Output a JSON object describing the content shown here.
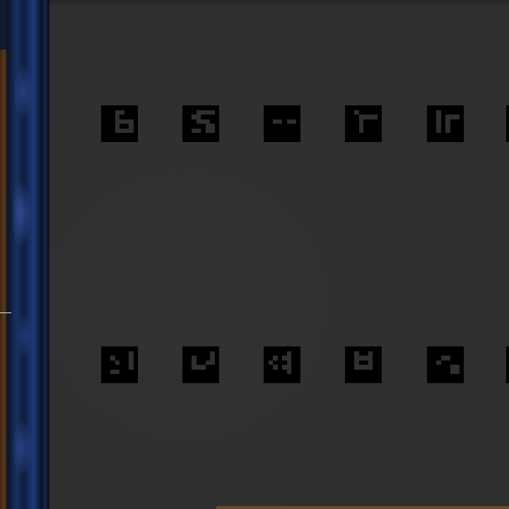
{
  "scene": {
    "background_color": "#2e2e2f",
    "pillar_color": "#18305e",
    "wood_color": "#5a3a1e",
    "marker_color": "#000000"
  },
  "markers": [
    {
      "id": "marker-r1c1",
      "bits": [
        "00000000",
        "00011000",
        "00010000",
        "00011110",
        "00010010",
        "00011110",
        "00000000",
        "00000000"
      ]
    },
    {
      "id": "marker-r1c2",
      "bits": [
        "00000000",
        "00011110",
        "00110000",
        "00011100",
        "00000110",
        "00110110",
        "00000000",
        "00000000"
      ]
    },
    {
      "id": "marker-r1c3",
      "bits": [
        "00000000",
        "00000000",
        "00000000",
        "00110110",
        "00000000",
        "00000000",
        "00000000",
        "00000000"
      ]
    },
    {
      "id": "marker-r1c4",
      "bits": [
        "00000000",
        "00100000",
        "00011110",
        "00010000",
        "00010000",
        "00010000",
        "00000000",
        "00000000"
      ]
    },
    {
      "id": "marker-r1c5",
      "bits": [
        "00000000",
        "00100000",
        "00101110",
        "00101000",
        "00101000",
        "00101000",
        "00000000",
        "00000000"
      ]
    },
    {
      "id": "marker-r2c1",
      "bits": [
        "00000000",
        "00000010",
        "00100010",
        "00010010",
        "00000010",
        "00110000",
        "00000000",
        "00000000"
      ]
    },
    {
      "id": "marker-r2c2",
      "bits": [
        "00000000",
        "00000010",
        "00100010",
        "00100110",
        "00111000",
        "00000000",
        "00000000",
        "00000000"
      ]
    },
    {
      "id": "marker-r2c3",
      "bits": [
        "00000000",
        "00000100",
        "00101100",
        "01000100",
        "00101100",
        "00000100",
        "00000000",
        "00000000"
      ]
    },
    {
      "id": "marker-r2c4",
      "bits": [
        "00000000",
        "00100100",
        "00111100",
        "00100100",
        "00111100",
        "00000000",
        "00000000",
        "00000000"
      ]
    },
    {
      "id": "marker-r2c5",
      "bits": [
        "00000000",
        "00000000",
        "00011000",
        "00100000",
        "00000110",
        "00000110",
        "00000000",
        "00000000"
      ]
    }
  ]
}
